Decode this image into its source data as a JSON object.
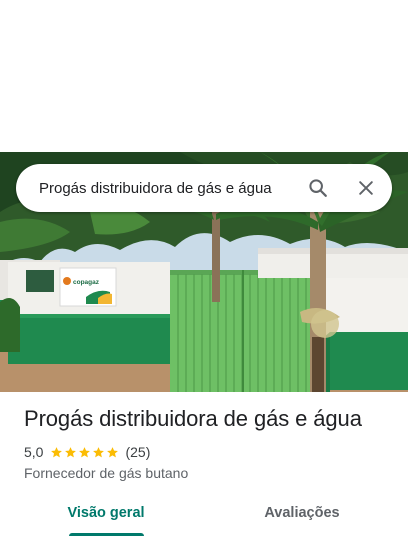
{
  "search": {
    "query": "Progás distribuidora de gás e água"
  },
  "photo": {
    "sign_text": "copagaz"
  },
  "place": {
    "name": "Progás distribuidora de gás e água",
    "rating": "5,0",
    "stars": 5,
    "review_count": "(25)",
    "category": "Fornecedor de gás butano"
  },
  "tabs": [
    {
      "label": "Visão geral",
      "selected": true
    },
    {
      "label": "Avaliações",
      "selected": false
    }
  ],
  "colors": {
    "accent": "#00796b",
    "star": "#fbbc04",
    "text_primary": "#202124",
    "text_secondary": "#5f6368"
  }
}
